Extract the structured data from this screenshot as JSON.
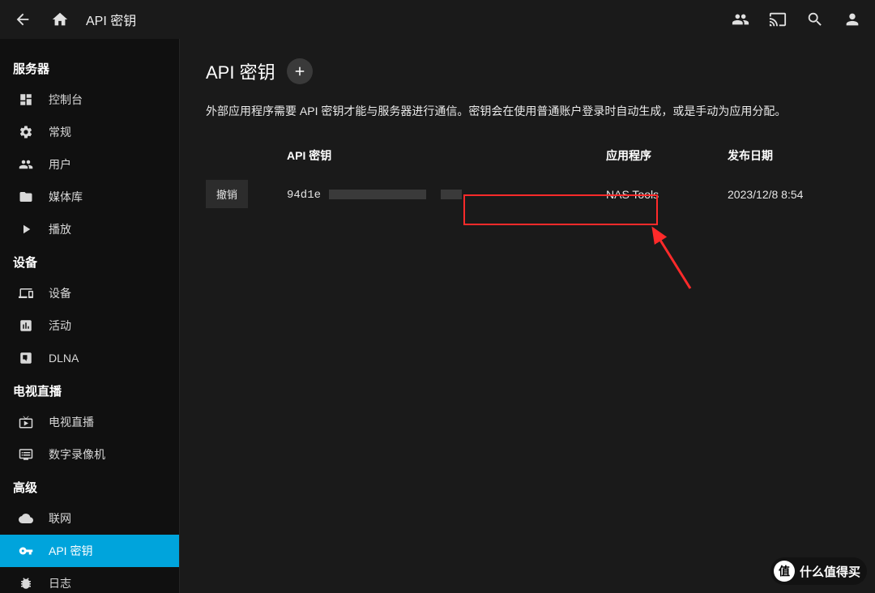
{
  "header": {
    "title": "API 密钥"
  },
  "sidebar": {
    "sections": [
      {
        "label": "服务器",
        "items": [
          {
            "id": "dashboard",
            "label": "控制台"
          },
          {
            "id": "general",
            "label": "常规"
          },
          {
            "id": "users",
            "label": "用户"
          },
          {
            "id": "library",
            "label": "媒体库"
          },
          {
            "id": "playback",
            "label": "播放"
          }
        ]
      },
      {
        "label": "设备",
        "items": [
          {
            "id": "devices",
            "label": "设备"
          },
          {
            "id": "activity",
            "label": "活动"
          },
          {
            "id": "dlna",
            "label": "DLNA"
          }
        ]
      },
      {
        "label": "电视直播",
        "items": [
          {
            "id": "livetv",
            "label": "电视直播"
          },
          {
            "id": "dvr",
            "label": "数字录像机"
          }
        ]
      },
      {
        "label": "高级",
        "items": [
          {
            "id": "network",
            "label": "联网"
          },
          {
            "id": "apikeys",
            "label": "API 密钥",
            "active": true
          },
          {
            "id": "logs",
            "label": "日志"
          }
        ]
      }
    ]
  },
  "main": {
    "pageTitle": "API 密钥",
    "description": "外部应用程序需要 API 密钥才能与服务器进行通信。密钥会在使用普通账户登录时自动生成，或是手动为应用分配。",
    "columns": {
      "apikey": "API 密钥",
      "app": "应用程序",
      "date": "发布日期"
    },
    "revokeLabel": "撤销",
    "rows": [
      {
        "key_visible_prefix": "94d1e",
        "app": "NAS Tools",
        "date": "2023/12/8 8:54"
      }
    ]
  },
  "brand": {
    "circle": "值",
    "text": "什么值得买"
  }
}
